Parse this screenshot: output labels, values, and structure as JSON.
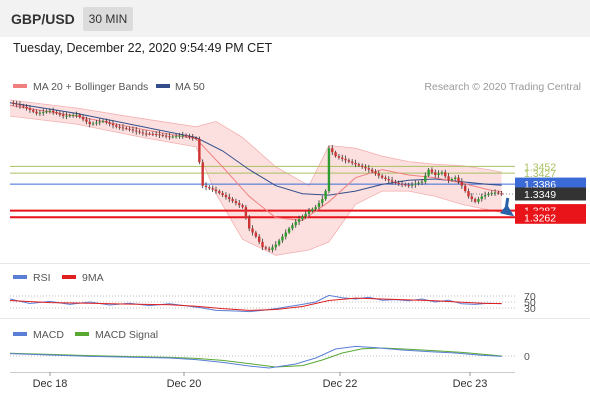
{
  "header": {
    "symbol": "GBP/USD",
    "timeframe": "30 MIN",
    "datetime": "Tuesday, December 22, 2020 9:54:49 PM CET"
  },
  "legend": {
    "ma20_label": "MA 20 + Bollinger Bands",
    "ma50_label": "MA 50",
    "rsi_label": "RSI",
    "rsi9_label": "9MA",
    "macd_label": "MACD",
    "macd_signal_label": "MACD Signal"
  },
  "copyright": "Research © 2020 Trading Central",
  "chart_data": {
    "type": "candlestick",
    "symbol": "GBP/USD",
    "interval": "30 MIN",
    "x_ticks": [
      "Dec 18",
      "Dec 20",
      "Dec 22",
      "Dec 23"
    ],
    "price_levels": [
      {
        "label": "1.3452",
        "value": 1.3452,
        "kind": "resistance",
        "color": "#a8c060"
      },
      {
        "label": "1.3427",
        "value": 1.3427,
        "kind": "resistance",
        "color": "#a8c060"
      },
      {
        "label": "1.3386",
        "value": 1.3386,
        "kind": "pivot",
        "color": "#3a6ad6"
      },
      {
        "label": "1.3349",
        "value": 1.3349,
        "kind": "last",
        "color": "#333333"
      },
      {
        "label": "1.3287",
        "value": 1.3287,
        "kind": "support",
        "color": "#e8141a"
      },
      {
        "label": "1.3262",
        "value": 1.3262,
        "kind": "support",
        "color": "#e8141a"
      }
    ],
    "forecast": "down",
    "series": [
      {
        "name": "MA 20 + Bollinger Bands",
        "color": "#f08080"
      },
      {
        "name": "MA 50",
        "color": "#334e8a"
      }
    ],
    "close_path": [
      [
        0,
        1.369
      ],
      [
        4,
        1.3675
      ],
      [
        8,
        1.365
      ],
      [
        12,
        1.366
      ],
      [
        16,
        1.364
      ],
      [
        20,
        1.3645
      ],
      [
        24,
        1.361
      ],
      [
        28,
        1.3622
      ],
      [
        32,
        1.36
      ],
      [
        36,
        1.359
      ],
      [
        40,
        1.3575
      ],
      [
        44,
        1.3572
      ],
      [
        48,
        1.3562
      ],
      [
        52,
        1.3568
      ],
      [
        56,
        1.3555
      ],
      [
        58,
        1.338
      ],
      [
        62,
        1.336
      ],
      [
        66,
        1.333
      ],
      [
        70,
        1.33
      ],
      [
        72,
        1.322
      ],
      [
        74,
        1.319
      ],
      [
        76,
        1.315
      ],
      [
        78,
        1.314
      ],
      [
        80,
        1.316
      ],
      [
        82,
        1.319
      ],
      [
        84,
        1.322
      ],
      [
        86,
        1.3245
      ],
      [
        88,
        1.3265
      ],
      [
        90,
        1.3285
      ],
      [
        92,
        1.33
      ],
      [
        94,
        1.333
      ],
      [
        95,
        1.336
      ],
      [
        96,
        1.352
      ],
      [
        98,
        1.349
      ],
      [
        100,
        1.348
      ],
      [
        104,
        1.346
      ],
      [
        108,
        1.344
      ],
      [
        112,
        1.341
      ],
      [
        116,
        1.339
      ],
      [
        120,
        1.338
      ],
      [
        124,
        1.3395
      ],
      [
        126,
        1.344
      ],
      [
        128,
        1.342
      ],
      [
        130,
        1.343
      ],
      [
        132,
        1.34
      ],
      [
        134,
        1.341
      ],
      [
        136,
        1.338
      ],
      [
        138,
        1.334
      ],
      [
        140,
        1.332
      ],
      [
        142,
        1.334
      ],
      [
        144,
        1.335
      ],
      [
        146,
        1.3355
      ],
      [
        148,
        1.3349
      ]
    ],
    "ma20": [
      [
        0,
        1.368
      ],
      [
        20,
        1.364
      ],
      [
        40,
        1.359
      ],
      [
        56,
        1.3555
      ],
      [
        64,
        1.345
      ],
      [
        72,
        1.334
      ],
      [
        80,
        1.326
      ],
      [
        88,
        1.325
      ],
      [
        96,
        1.332
      ],
      [
        104,
        1.341
      ],
      [
        112,
        1.344
      ],
      [
        120,
        1.342
      ],
      [
        128,
        1.341
      ],
      [
        136,
        1.339
      ],
      [
        144,
        1.3365
      ],
      [
        148,
        1.3358
      ]
    ],
    "ma50": [
      [
        0,
        1.369
      ],
      [
        20,
        1.365
      ],
      [
        40,
        1.36
      ],
      [
        56,
        1.356
      ],
      [
        64,
        1.351
      ],
      [
        72,
        1.344
      ],
      [
        80,
        1.338
      ],
      [
        88,
        1.335
      ],
      [
        96,
        1.3345
      ],
      [
        104,
        1.336
      ],
      [
        112,
        1.3385
      ],
      [
        120,
        1.34
      ],
      [
        128,
        1.3405
      ],
      [
        136,
        1.3395
      ],
      [
        144,
        1.3385
      ],
      [
        148,
        1.3382
      ]
    ],
    "bb_upper": [
      [
        0,
        1.37
      ],
      [
        20,
        1.367
      ],
      [
        40,
        1.363
      ],
      [
        56,
        1.36
      ],
      [
        62,
        1.362
      ],
      [
        70,
        1.356
      ],
      [
        80,
        1.345
      ],
      [
        90,
        1.338
      ],
      [
        96,
        1.353
      ],
      [
        104,
        1.352
      ],
      [
        112,
        1.349
      ],
      [
        120,
        1.347
      ],
      [
        128,
        1.346
      ],
      [
        136,
        1.3455
      ],
      [
        144,
        1.344
      ],
      [
        148,
        1.343
      ]
    ],
    "bb_lower": [
      [
        0,
        1.364
      ],
      [
        20,
        1.361
      ],
      [
        40,
        1.356
      ],
      [
        56,
        1.3525
      ],
      [
        62,
        1.335
      ],
      [
        70,
        1.318
      ],
      [
        80,
        1.312
      ],
      [
        90,
        1.314
      ],
      [
        96,
        1.317
      ],
      [
        104,
        1.331
      ],
      [
        112,
        1.336
      ],
      [
        120,
        1.336
      ],
      [
        128,
        1.334
      ],
      [
        136,
        1.331
      ],
      [
        144,
        1.329
      ],
      [
        148,
        1.328
      ]
    ],
    "y_range": [
      1.311,
      1.37
    ],
    "x_range": [
      0,
      152
    ],
    "rsi": {
      "levels": [
        70,
        50,
        30
      ],
      "level_labels": [
        "70",
        "50",
        "30"
      ],
      "rsi_path": [
        [
          0,
          60
        ],
        [
          6,
          45
        ],
        [
          12,
          52
        ],
        [
          18,
          42
        ],
        [
          24,
          50
        ],
        [
          30,
          40
        ],
        [
          36,
          46
        ],
        [
          42,
          38
        ],
        [
          48,
          44
        ],
        [
          54,
          36
        ],
        [
          58,
          30
        ],
        [
          62,
          22
        ],
        [
          68,
          20
        ],
        [
          72,
          18
        ],
        [
          76,
          22
        ],
        [
          80,
          28
        ],
        [
          84,
          35
        ],
        [
          88,
          42
        ],
        [
          92,
          50
        ],
        [
          96,
          72
        ],
        [
          100,
          64
        ],
        [
          104,
          60
        ],
        [
          108,
          66
        ],
        [
          112,
          56
        ],
        [
          116,
          58
        ],
        [
          120,
          54
        ],
        [
          124,
          60
        ],
        [
          128,
          50
        ],
        [
          132,
          56
        ],
        [
          136,
          44
        ],
        [
          140,
          42
        ],
        [
          144,
          46
        ],
        [
          148,
          44
        ]
      ],
      "ma9_path": [
        [
          0,
          55
        ],
        [
          12,
          48
        ],
        [
          24,
          46
        ],
        [
          36,
          43
        ],
        [
          48,
          41
        ],
        [
          56,
          36
        ],
        [
          64,
          28
        ],
        [
          72,
          22
        ],
        [
          80,
          25
        ],
        [
          88,
          35
        ],
        [
          96,
          55
        ],
        [
          104,
          63
        ],
        [
          112,
          60
        ],
        [
          120,
          57
        ],
        [
          128,
          54
        ],
        [
          136,
          49
        ],
        [
          144,
          45
        ],
        [
          148,
          45
        ]
      ]
    },
    "macd": {
      "zero_label": "0",
      "macd_path": [
        [
          0,
          0.0012
        ],
        [
          12,
          0.0005
        ],
        [
          24,
          -0.0002
        ],
        [
          36,
          -0.0006
        ],
        [
          48,
          -0.001
        ],
        [
          56,
          -0.0018
        ],
        [
          64,
          -0.0032
        ],
        [
          72,
          -0.005
        ],
        [
          78,
          -0.006
        ],
        [
          86,
          -0.004
        ],
        [
          92,
          -0.001
        ],
        [
          98,
          0.0035
        ],
        [
          104,
          0.0048
        ],
        [
          110,
          0.0042
        ],
        [
          118,
          0.003
        ],
        [
          126,
          0.0022
        ],
        [
          134,
          0.0015
        ],
        [
          142,
          0.0004
        ],
        [
          148,
          -0.0002
        ]
      ],
      "signal_path": [
        [
          0,
          0.0014
        ],
        [
          12,
          0.0008
        ],
        [
          24,
          0.0002
        ],
        [
          36,
          -0.0003
        ],
        [
          48,
          -0.0007
        ],
        [
          56,
          -0.0012
        ],
        [
          64,
          -0.0022
        ],
        [
          72,
          -0.0038
        ],
        [
          80,
          -0.0055
        ],
        [
          88,
          -0.0048
        ],
        [
          94,
          -0.002
        ],
        [
          100,
          0.0015
        ],
        [
          106,
          0.0036
        ],
        [
          112,
          0.004
        ],
        [
          120,
          0.0034
        ],
        [
          128,
          0.0026
        ],
        [
          136,
          0.0018
        ],
        [
          144,
          0.0006
        ],
        [
          148,
          0.0
        ]
      ],
      "y_range": [
        -0.007,
        0.006
      ]
    }
  },
  "colors": {
    "ma20": "#f08080",
    "ma50": "#334e8a",
    "bollinger_fill": "#fbd5d5",
    "candle_up": "#2f9a2f",
    "candle_down": "#cc3333",
    "resistance": "#a8c060",
    "pivot": "#3a6ad6",
    "support": "#e8141a",
    "arrow": "#2962a8",
    "rsi": "#5b7fd6",
    "rsi_ma": "#e02020",
    "macd": "#5b7fd6",
    "macd_signal": "#58a832"
  }
}
